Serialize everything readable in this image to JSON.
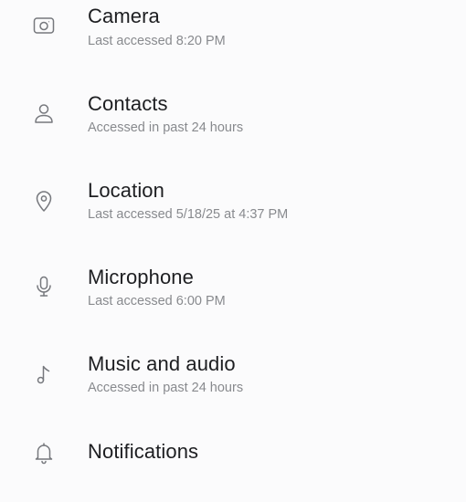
{
  "permissions": [
    {
      "title": "Camera",
      "subtitle": "Last accessed 8:20 PM",
      "icon": "camera-icon"
    },
    {
      "title": "Contacts",
      "subtitle": "Accessed in past 24 hours",
      "icon": "person-icon"
    },
    {
      "title": "Location",
      "subtitle": "Last accessed 5/18/25 at 4:37 PM",
      "icon": "location-pin-icon"
    },
    {
      "title": "Microphone",
      "subtitle": "Last accessed 6:00 PM",
      "icon": "microphone-icon"
    },
    {
      "title": "Music and audio",
      "subtitle": "Accessed in past 24 hours",
      "icon": "music-note-icon"
    },
    {
      "title": "Notifications",
      "subtitle": "",
      "icon": "bell-icon"
    }
  ]
}
